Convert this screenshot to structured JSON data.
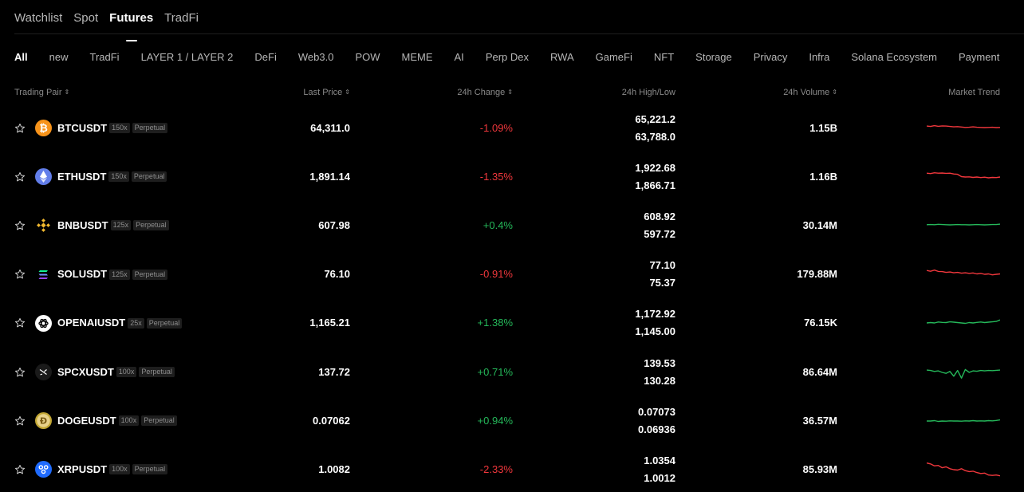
{
  "top_tabs": [
    {
      "label": "Watchlist",
      "active": false
    },
    {
      "label": "Spot",
      "active": false
    },
    {
      "label": "Futures",
      "active": true
    },
    {
      "label": "TradFi",
      "active": false
    }
  ],
  "categories": [
    {
      "label": "All",
      "active": true
    },
    {
      "label": "new"
    },
    {
      "label": "TradFi"
    },
    {
      "label": "LAYER 1 / LAYER 2"
    },
    {
      "label": "DeFi"
    },
    {
      "label": "Web3.0"
    },
    {
      "label": "POW"
    },
    {
      "label": "MEME"
    },
    {
      "label": "AI"
    },
    {
      "label": "Perp Dex"
    },
    {
      "label": "RWA"
    },
    {
      "label": "GameFi"
    },
    {
      "label": "NFT"
    },
    {
      "label": "Storage"
    },
    {
      "label": "Privacy"
    },
    {
      "label": "Infra"
    },
    {
      "label": "Solana Ecosystem"
    },
    {
      "label": "Payment"
    }
  ],
  "table": {
    "headers": {
      "pair": "Trading Pair",
      "last_price": "Last Price",
      "change": "24h Change",
      "high_low": "24h High/Low",
      "volume": "24h Volume",
      "trend": "Market Trend"
    },
    "rows": [
      {
        "symbol": "BTCUSDT",
        "leverage": "150x",
        "type": "Perpetual",
        "coin_icon": "btc-icon",
        "coin_color": "#f7931a",
        "last_price": "64,311.0",
        "change": "-1.09%",
        "direction": "down",
        "high": "65,221.2",
        "low": "63,788.0",
        "volume": "1.15B",
        "trend": [
          0.62,
          0.6,
          0.64,
          0.61,
          0.63,
          0.62,
          0.6,
          0.58,
          0.59,
          0.57,
          0.55,
          0.56,
          0.58,
          0.56,
          0.55,
          0.54,
          0.55,
          0.56,
          0.54,
          0.55
        ]
      },
      {
        "symbol": "ETHUSDT",
        "leverage": "150x",
        "type": "Perpetual",
        "coin_icon": "eth-icon",
        "coin_color": "#627eea",
        "last_price": "1,891.14",
        "change": "-1.35%",
        "direction": "down",
        "high": "1,922.68",
        "low": "1,866.71",
        "volume": "1.16B",
        "trend": [
          0.7,
          0.68,
          0.72,
          0.7,
          0.71,
          0.69,
          0.7,
          0.66,
          0.64,
          0.52,
          0.5,
          0.51,
          0.48,
          0.5,
          0.47,
          0.49,
          0.46,
          0.48,
          0.47,
          0.5
        ]
      },
      {
        "symbol": "BNBUSDT",
        "leverage": "125x",
        "type": "Perpetual",
        "coin_icon": "bnb-icon",
        "coin_color": "#f3ba2f",
        "last_price": "607.98",
        "change": "+0.4%",
        "direction": "up",
        "high": "608.92",
        "low": "597.72",
        "volume": "30.14M",
        "trend": [
          0.55,
          0.56,
          0.55,
          0.57,
          0.56,
          0.55,
          0.54,
          0.55,
          0.56,
          0.55,
          0.55,
          0.54,
          0.55,
          0.56,
          0.55,
          0.54,
          0.55,
          0.56,
          0.56,
          0.58
        ]
      },
      {
        "symbol": "SOLUSDT",
        "leverage": "125x",
        "type": "Perpetual",
        "coin_icon": "sol-icon",
        "coin_color": "#14f195",
        "last_price": "76.10",
        "change": "-0.91%",
        "direction": "down",
        "high": "77.10",
        "low": "75.37",
        "volume": "179.88M",
        "trend": [
          0.7,
          0.66,
          0.72,
          0.65,
          0.64,
          0.6,
          0.62,
          0.58,
          0.6,
          0.56,
          0.58,
          0.55,
          0.57,
          0.52,
          0.55,
          0.5,
          0.52,
          0.47,
          0.5,
          0.52
        ]
      },
      {
        "symbol": "OPENAIUSDT",
        "leverage": "25x",
        "type": "Perpetual",
        "coin_icon": "openai-icon",
        "coin_color": "#ffffff",
        "last_price": "1,165.21",
        "change": "+1.38%",
        "direction": "up",
        "high": "1,172.92",
        "low": "1,145.00",
        "volume": "76.15K",
        "trend": [
          0.5,
          0.52,
          0.5,
          0.55,
          0.53,
          0.52,
          0.56,
          0.54,
          0.52,
          0.5,
          0.48,
          0.52,
          0.5,
          0.53,
          0.55,
          0.52,
          0.54,
          0.56,
          0.58,
          0.66
        ]
      },
      {
        "symbol": "SPCXUSDT",
        "leverage": "100x",
        "type": "Perpetual",
        "coin_icon": "spacex-icon",
        "coin_color": "#1a1a1a",
        "last_price": "137.72",
        "change": "+0.71%",
        "direction": "up",
        "high": "139.53",
        "low": "130.28",
        "volume": "86.64M",
        "trend": [
          0.62,
          0.6,
          0.55,
          0.58,
          0.5,
          0.45,
          0.55,
          0.3,
          0.6,
          0.2,
          0.65,
          0.5,
          0.58,
          0.56,
          0.6,
          0.58,
          0.6,
          0.59,
          0.61,
          0.62
        ]
      },
      {
        "symbol": "DOGEUSDT",
        "leverage": "100x",
        "type": "Perpetual",
        "coin_icon": "doge-icon",
        "coin_color": "#c2a633",
        "last_price": "0.07062",
        "change": "+0.94%",
        "direction": "up",
        "high": "0.07073",
        "low": "0.06936",
        "volume": "36.57M",
        "trend": [
          0.5,
          0.5,
          0.52,
          0.48,
          0.5,
          0.49,
          0.51,
          0.5,
          0.5,
          0.49,
          0.51,
          0.5,
          0.52,
          0.5,
          0.51,
          0.5,
          0.52,
          0.51,
          0.53,
          0.56
        ]
      },
      {
        "symbol": "XRPUSDT",
        "leverage": "100x",
        "type": "Perpetual",
        "coin_icon": "xrp-icon",
        "coin_color": "#1f6bff",
        "last_price": "1.0082",
        "change": "-2.33%",
        "direction": "down",
        "high": "1.0354",
        "low": "1.0012",
        "volume": "85.93M",
        "trend": [
          0.85,
          0.8,
          0.7,
          0.72,
          0.6,
          0.65,
          0.55,
          0.5,
          0.48,
          0.55,
          0.45,
          0.4,
          0.42,
          0.35,
          0.3,
          0.32,
          0.22,
          0.2,
          0.22,
          0.18
        ]
      }
    ]
  },
  "colors": {
    "up": "#25b85a",
    "down": "#f0373c"
  }
}
